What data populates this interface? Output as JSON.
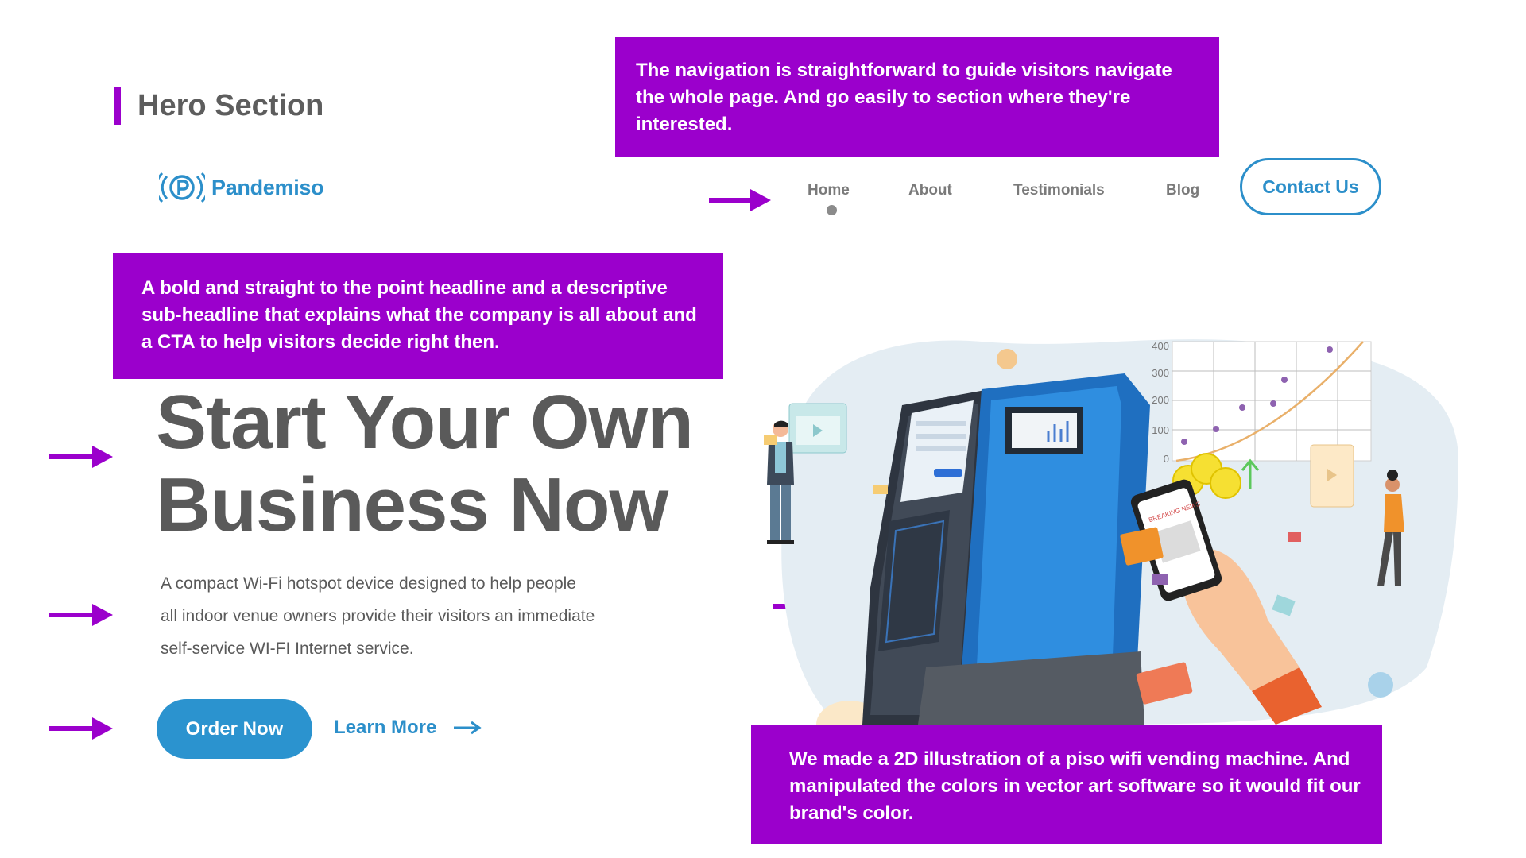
{
  "section": {
    "title": "Hero Section"
  },
  "brand": {
    "name": "Pandemiso",
    "color": "#2c8fca",
    "icon": "wifi-p-logo-icon"
  },
  "nav": {
    "items": [
      {
        "label": "Home",
        "active": true
      },
      {
        "label": "About"
      },
      {
        "label": "Testimonials"
      },
      {
        "label": "Blog"
      }
    ],
    "contact_label": "Contact Us"
  },
  "notes": {
    "navigation": "The navigation is straightforward to guide visitors navigate the whole page. And go easily to section where they're interested.",
    "headline": "A bold and straight to the point headline and a descriptive sub-headline that explains what the company is all about and a CTA to help visitors decide right then.",
    "illustration": "We made a 2D illustration of a piso wifi vending machine. And manipulated the colors in vector art software so it would fit our brand's color."
  },
  "hero": {
    "headline_line1": "Start Your Own",
    "headline_line2": "Business Now",
    "subline_line1": "A compact Wi-Fi hotspot device designed to help people",
    "subline_line2": "all indoor venue owners provide their visitors an immediate",
    "subline_line3": "self-service WI-FI Internet service.",
    "order_label": "Order Now",
    "learn_label": "Learn More"
  },
  "illustration": {
    "chart_ticks": [
      "400",
      "300",
      "200",
      "100",
      "0"
    ],
    "phone_title": "BREAKING NEWS"
  },
  "colors": {
    "annotation": "#9b00cc",
    "brand_blue": "#2b93cf",
    "text_gray": "#5a5a5a"
  }
}
